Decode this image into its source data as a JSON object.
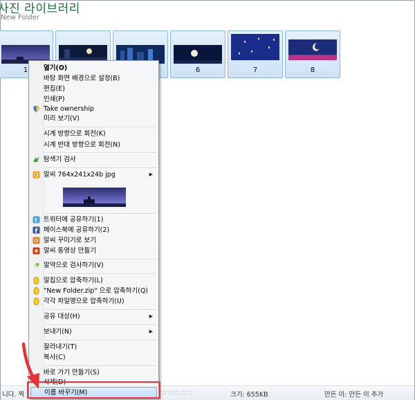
{
  "library": {
    "title": "사진 라이브러리",
    "folder": "New Folder"
  },
  "thumbnails": [
    {
      "num": "1"
    },
    {
      "num": ""
    },
    {
      "num": ""
    },
    {
      "num": "6"
    },
    {
      "num": "7"
    },
    {
      "num": "8"
    }
  ],
  "menu": {
    "items": [
      {
        "label": "열기(O)"
      },
      {
        "label": "바탕 화면 배경으로 설정(B)"
      },
      {
        "label": "편집(E)"
      },
      {
        "label": "인쇄(P)"
      },
      {
        "label": "Take ownership",
        "icon": "shield-icon"
      },
      {
        "label": "미리 보기(V)"
      },
      {
        "label": "시계 방향으로 회전(K)"
      },
      {
        "label": "시계 반대 방향으로 회전(N)"
      },
      {
        "label": "탐색기 검사",
        "icon": "explorer-check-icon"
      },
      {
        "label": "알씨 764x241x24b jpg",
        "icon": "alsee-icon"
      },
      {
        "label": "트위터에 공유하기(1)",
        "icon": "twitter-icon"
      },
      {
        "label": "페이스북에 공유하기(2)",
        "icon": "facebook-icon"
      },
      {
        "label": "알씨 꾸미기로 보기",
        "icon": "alsee-decorate-icon"
      },
      {
        "label": "알씨 동영상 만들기",
        "icon": "alsee-video-icon"
      },
      {
        "label": "알약으로 검사하기(V)",
        "icon": "alyac-icon"
      },
      {
        "label": "알집으로 압축하기(L)",
        "icon": "alzip-icon"
      },
      {
        "label": "\"New Folder.zip\" 으로 압축하기(Q)",
        "icon": "alzip-icon"
      },
      {
        "label": "각각 파일명으로 압축하기(U)",
        "icon": "alzip-icon"
      },
      {
        "label": "공유 대상(H)"
      },
      {
        "label": "보내기(N)"
      },
      {
        "label": "잘라내기(T)"
      },
      {
        "label": "복사(C)"
      },
      {
        "label": "바로 가기 만들기(S)"
      },
      {
        "label": "삭제(D)"
      },
      {
        "label": "이름 바꾸기(M)"
      }
    ]
  },
  "status": {
    "left": "니다. 찍",
    "size": "크기: 655KB",
    "creator": "만든 이: 만든 이 추가"
  },
  "colors": {
    "title_green": "#1e6e3c",
    "highlight_border": "#e8333b",
    "menu_bg": "#f5f6f7"
  }
}
